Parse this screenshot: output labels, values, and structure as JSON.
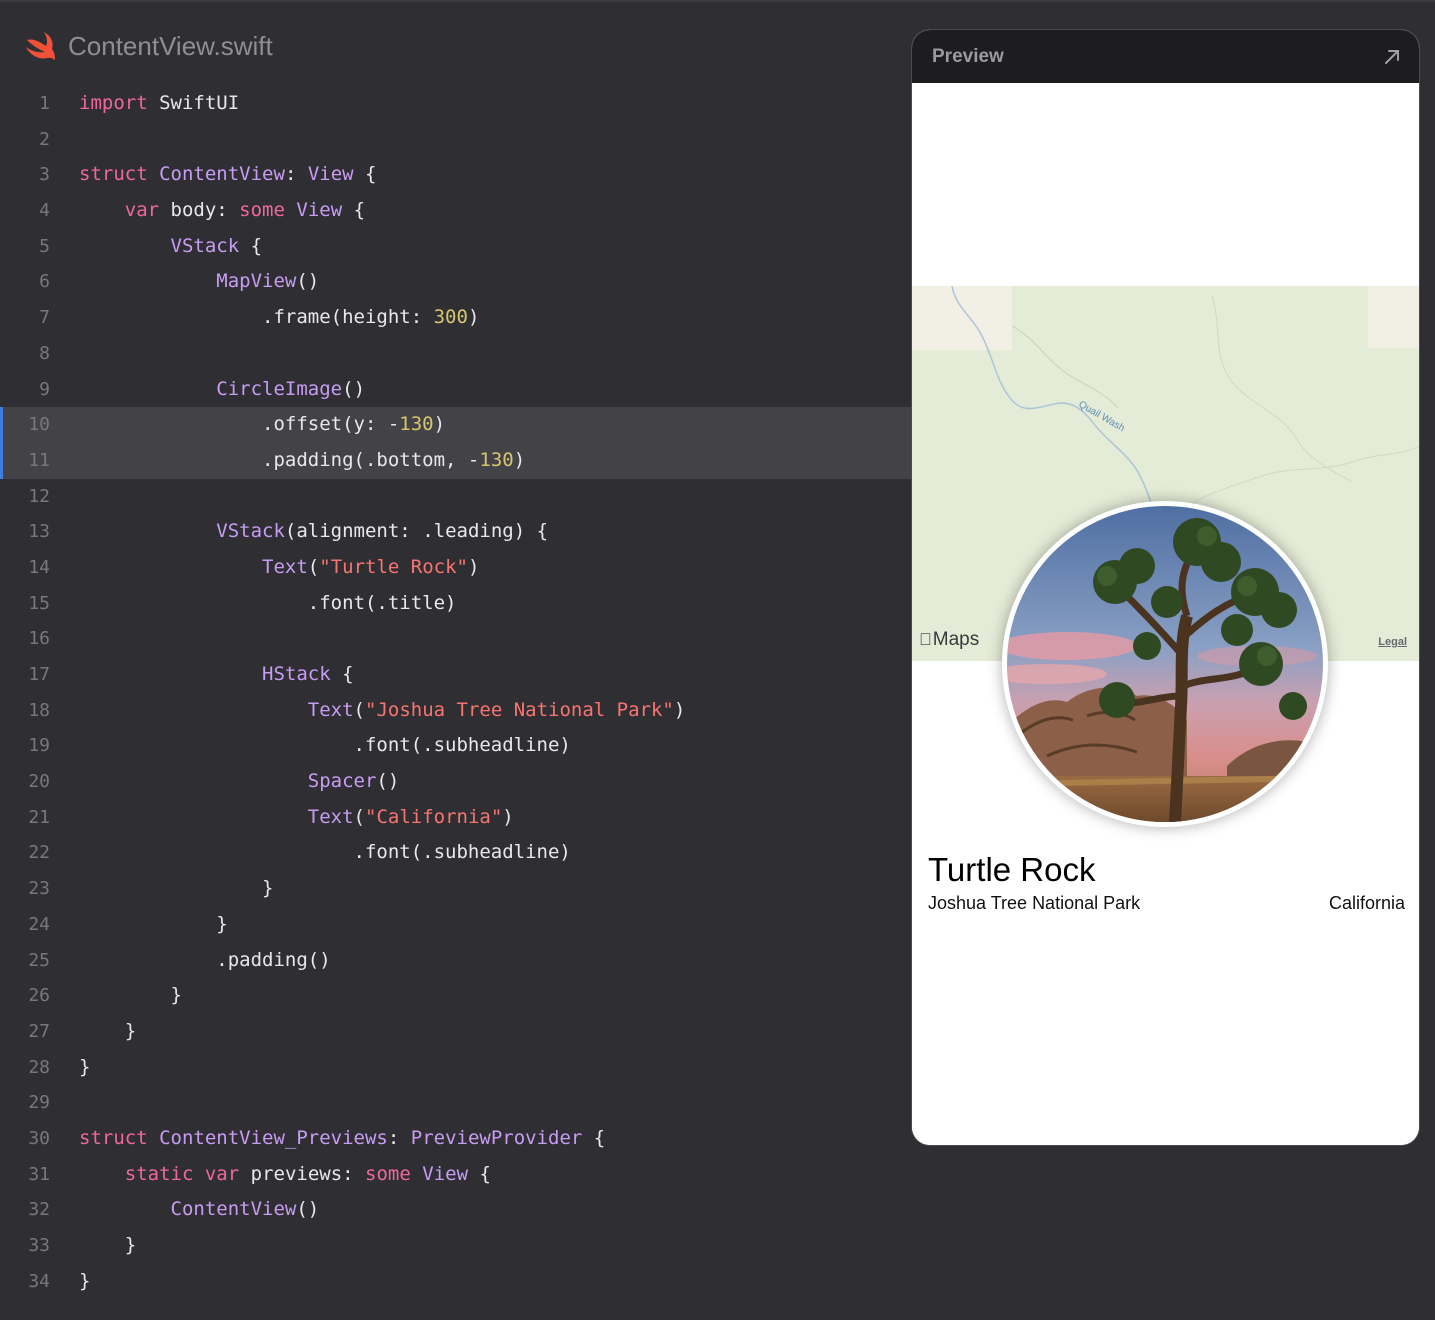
{
  "editor": {
    "filename": "ContentView.swift",
    "icon": "swift-icon",
    "highlighted_lines": [
      10,
      11
    ],
    "lines": [
      {
        "n": "1",
        "tokens": [
          [
            "kw",
            "import"
          ],
          [
            "p",
            " SwiftUI"
          ]
        ]
      },
      {
        "n": "2",
        "tokens": []
      },
      {
        "n": "3",
        "tokens": [
          [
            "kw",
            "struct"
          ],
          [
            "p",
            " "
          ],
          [
            "ty",
            "ContentView"
          ],
          [
            "p",
            ": "
          ],
          [
            "ty",
            "View"
          ],
          [
            "p",
            " {"
          ]
        ]
      },
      {
        "n": "4",
        "tokens": [
          [
            "p",
            "    "
          ],
          [
            "kw",
            "var"
          ],
          [
            "p",
            " body: "
          ],
          [
            "kw",
            "some"
          ],
          [
            "p",
            " "
          ],
          [
            "ty",
            "View"
          ],
          [
            "p",
            " {"
          ]
        ]
      },
      {
        "n": "5",
        "tokens": [
          [
            "p",
            "        "
          ],
          [
            "ty",
            "VStack"
          ],
          [
            "p",
            " {"
          ]
        ]
      },
      {
        "n": "6",
        "tokens": [
          [
            "p",
            "            "
          ],
          [
            "ty",
            "MapView"
          ],
          [
            "p",
            "()"
          ]
        ]
      },
      {
        "n": "7",
        "tokens": [
          [
            "p",
            "                .frame(height: "
          ],
          [
            "nu",
            "300"
          ],
          [
            "p",
            ")"
          ]
        ]
      },
      {
        "n": "8",
        "tokens": []
      },
      {
        "n": "9",
        "tokens": [
          [
            "p",
            "            "
          ],
          [
            "ty",
            "CircleImage"
          ],
          [
            "p",
            "()"
          ]
        ]
      },
      {
        "n": "10",
        "tokens": [
          [
            "p",
            "                .offset(y: -"
          ],
          [
            "nu",
            "130"
          ],
          [
            "p",
            ")"
          ]
        ]
      },
      {
        "n": "11",
        "tokens": [
          [
            "p",
            "                .padding(.bottom, -"
          ],
          [
            "nu",
            "130"
          ],
          [
            "p",
            ")"
          ]
        ]
      },
      {
        "n": "12",
        "tokens": []
      },
      {
        "n": "13",
        "tokens": [
          [
            "p",
            "            "
          ],
          [
            "ty",
            "VStack"
          ],
          [
            "p",
            "(alignment: .leading) {"
          ]
        ]
      },
      {
        "n": "14",
        "tokens": [
          [
            "p",
            "                "
          ],
          [
            "ty",
            "Text"
          ],
          [
            "p",
            "("
          ],
          [
            "st",
            "\"Turtle Rock\""
          ],
          [
            "p",
            ")"
          ]
        ]
      },
      {
        "n": "15",
        "tokens": [
          [
            "p",
            "                    .font(.title)"
          ]
        ]
      },
      {
        "n": "16",
        "tokens": []
      },
      {
        "n": "17",
        "tokens": [
          [
            "p",
            "                "
          ],
          [
            "ty",
            "HStack"
          ],
          [
            "p",
            " {"
          ]
        ]
      },
      {
        "n": "18",
        "tokens": [
          [
            "p",
            "                    "
          ],
          [
            "ty",
            "Text"
          ],
          [
            "p",
            "("
          ],
          [
            "st",
            "\"Joshua Tree National Park\""
          ],
          [
            "p",
            ")"
          ]
        ]
      },
      {
        "n": "19",
        "tokens": [
          [
            "p",
            "                        .font(.subheadline)"
          ]
        ]
      },
      {
        "n": "20",
        "tokens": [
          [
            "p",
            "                    "
          ],
          [
            "ty",
            "Spacer"
          ],
          [
            "p",
            "()"
          ]
        ]
      },
      {
        "n": "21",
        "tokens": [
          [
            "p",
            "                    "
          ],
          [
            "ty",
            "Text"
          ],
          [
            "p",
            "("
          ],
          [
            "st",
            "\"California\""
          ],
          [
            "p",
            ")"
          ]
        ]
      },
      {
        "n": "22",
        "tokens": [
          [
            "p",
            "                        .font(.subheadline)"
          ]
        ]
      },
      {
        "n": "23",
        "tokens": [
          [
            "p",
            "                }"
          ]
        ]
      },
      {
        "n": "24",
        "tokens": [
          [
            "p",
            "            }"
          ]
        ]
      },
      {
        "n": "25",
        "tokens": [
          [
            "p",
            "            .padding()"
          ]
        ]
      },
      {
        "n": "26",
        "tokens": [
          [
            "p",
            "        }"
          ]
        ]
      },
      {
        "n": "27",
        "tokens": [
          [
            "p",
            "    }"
          ]
        ]
      },
      {
        "n": "28",
        "tokens": [
          [
            "p",
            "}"
          ]
        ]
      },
      {
        "n": "29",
        "tokens": []
      },
      {
        "n": "30",
        "tokens": [
          [
            "kw",
            "struct"
          ],
          [
            "p",
            " "
          ],
          [
            "ty",
            "ContentView_Previews"
          ],
          [
            "p",
            ": "
          ],
          [
            "ty",
            "PreviewProvider"
          ],
          [
            "p",
            " {"
          ]
        ]
      },
      {
        "n": "31",
        "tokens": [
          [
            "p",
            "    "
          ],
          [
            "kw",
            "static"
          ],
          [
            "p",
            " "
          ],
          [
            "kw",
            "var"
          ],
          [
            "p",
            " previews: "
          ],
          [
            "kw",
            "some"
          ],
          [
            "p",
            " "
          ],
          [
            "ty",
            "View"
          ],
          [
            "p",
            " {"
          ]
        ]
      },
      {
        "n": "32",
        "tokens": [
          [
            "p",
            "        "
          ],
          [
            "ty",
            "ContentView"
          ],
          [
            "p",
            "()"
          ]
        ]
      },
      {
        "n": "33",
        "tokens": [
          [
            "p",
            "    }"
          ]
        ]
      },
      {
        "n": "34",
        "tokens": [
          [
            "p",
            "}"
          ]
        ]
      }
    ]
  },
  "preview": {
    "title": "Preview",
    "expand_icon": "arrow-up-right-icon",
    "map": {
      "brand": "Maps",
      "brand_icon": "apple-logo-icon",
      "legal": "Legal",
      "label": "Quail Wash"
    },
    "place": {
      "title": "Turtle Rock",
      "park": "Joshua Tree National Park",
      "state": "California"
    }
  }
}
